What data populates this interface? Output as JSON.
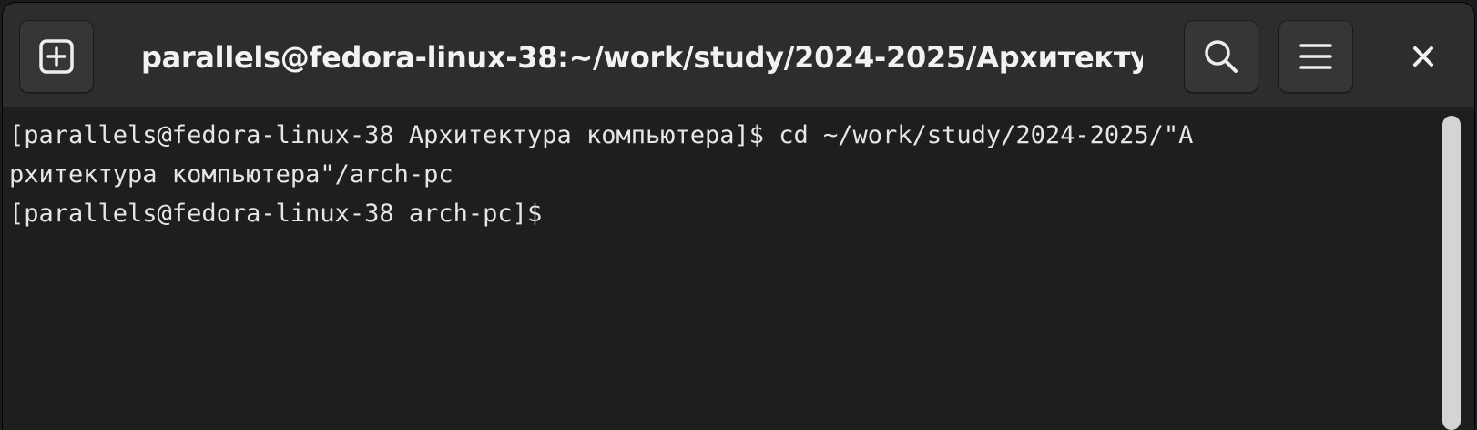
{
  "window": {
    "title": "parallels@fedora-linux-38:~/work/study/2024-2025/Архитекту..."
  },
  "headerbar": {
    "new_tab_icon": "new-tab-icon",
    "search_icon": "search-icon",
    "menu_icon": "hamburger-menu-icon",
    "close_icon": "close-icon"
  },
  "terminal": {
    "lines": [
      "[parallels@fedora-linux-38 Архитектура компьютера]$ cd ~/work/study/2024-2025/\"А",
      "рхитектура компьютера\"/arch-pc",
      "[parallels@fedora-linux-38 arch-pc]$ "
    ]
  },
  "colors": {
    "headerbar_bg": "#2d2d2d",
    "terminal_bg": "#1e1e1e",
    "text": "#e6e6e6",
    "scrollbar": "#d4d4d4"
  }
}
